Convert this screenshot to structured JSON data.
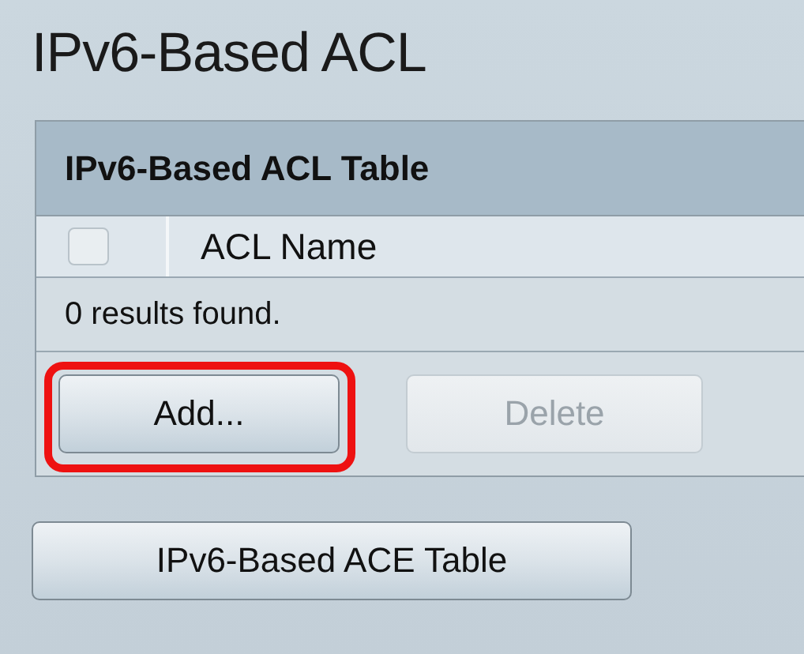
{
  "page_title": "IPv6-Based ACL",
  "table": {
    "title": "IPv6-Based ACL Table",
    "select_all": {
      "checked": false
    },
    "columns": [
      "ACL Name"
    ],
    "status": "0 results found."
  },
  "buttons": [
    {
      "label": "Add...",
      "disabled": false,
      "highlighted": true
    },
    {
      "label": "Delete",
      "disabled": true,
      "highlighted": false
    }
  ],
  "footer_button": {
    "label": "IPv6-Based ACE Table"
  }
}
